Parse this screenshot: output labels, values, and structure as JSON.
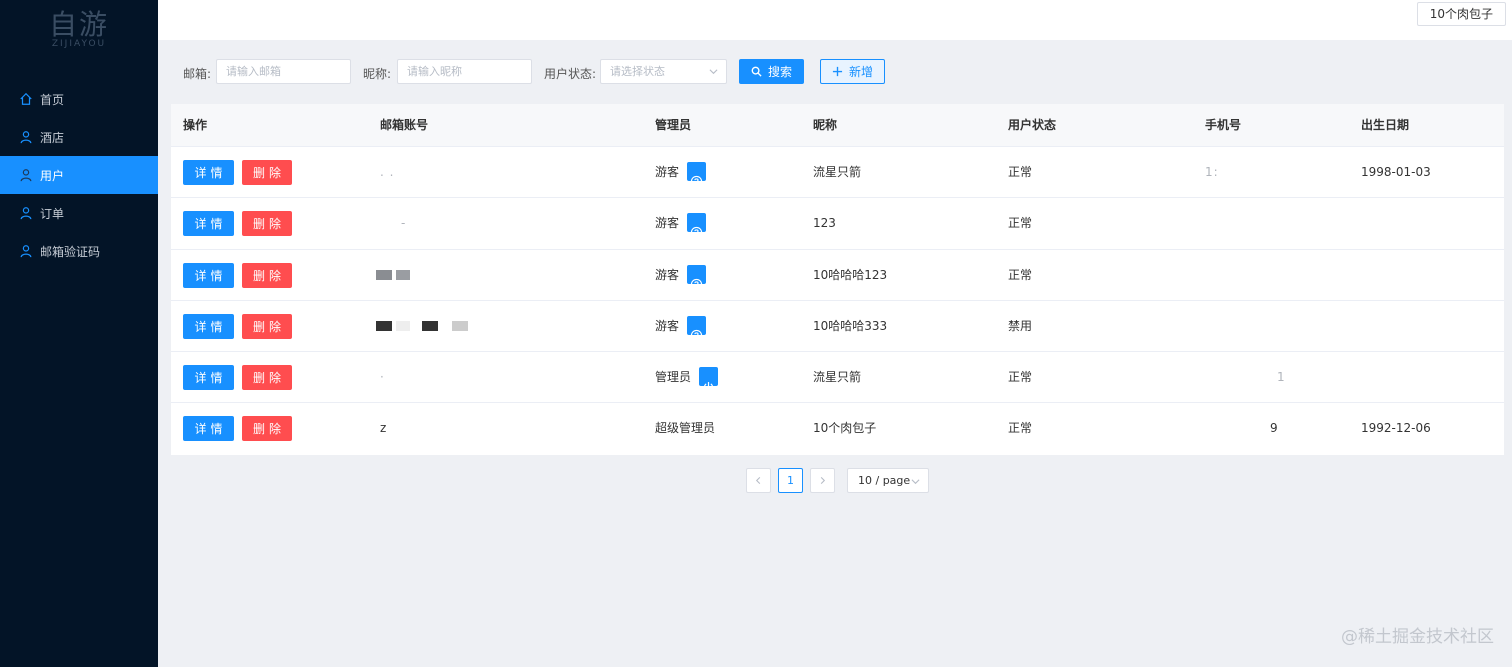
{
  "logo": {
    "title": "自游",
    "subtitle": "ZIJIAYOU"
  },
  "sidebar": {
    "items": [
      {
        "label": "首页",
        "icon": "home-icon"
      },
      {
        "label": "酒店",
        "icon": "user-icon"
      },
      {
        "label": "用户",
        "icon": "user-icon",
        "active": true
      },
      {
        "label": "订单",
        "icon": "user-icon"
      },
      {
        "label": "邮箱验证码",
        "icon": "user-icon"
      }
    ]
  },
  "header": {
    "user_name": "10个肉包子"
  },
  "search": {
    "email_label": "邮箱:",
    "email_placeholder": "请输入邮箱",
    "nickname_label": "昵称:",
    "nickname_placeholder": "请输入昵称",
    "status_label": "用户状态:",
    "status_placeholder": "请选择状态",
    "search_button": "搜索",
    "add_button": "新增"
  },
  "table": {
    "columns": [
      "操作",
      "邮箱账号",
      "管理员",
      "昵称",
      "用户状态",
      "手机号",
      "出生日期"
    ],
    "detail_label": "详情",
    "delete_label": "删除",
    "rows": [
      {
        "email": ". .",
        "role": "游客",
        "role_icon": "question-icon",
        "nickname": "流星只箭",
        "status": "正常",
        "phone": "1:",
        "birth": "1998-01-03"
      },
      {
        "email": "-",
        "role": "游客",
        "role_icon": "question-icon",
        "nickname": "123",
        "status": "正常",
        "phone": "",
        "birth": ""
      },
      {
        "email": "",
        "role": "游客",
        "role_icon": "question-icon",
        "nickname": "10哈哈哈123",
        "status": "正常",
        "phone": "",
        "birth": ""
      },
      {
        "email": "",
        "role": "游客",
        "role_icon": "question-icon",
        "nickname": "10哈哈哈333",
        "status": "禁用",
        "phone": "",
        "birth": ""
      },
      {
        "email": "·",
        "role": "管理员",
        "role_icon": "power-icon",
        "nickname": "流星只箭",
        "status": "正常",
        "phone": "1",
        "birth": ""
      },
      {
        "email": "z",
        "role": "超级管理员",
        "role_icon": "",
        "nickname": "10个肉包子",
        "status": "正常",
        "phone": "9",
        "birth": "1992-12-06"
      }
    ]
  },
  "pagination": {
    "current": "1",
    "page_size": "10 / page"
  },
  "watermark": "@稀土掘金技术社区",
  "colors": {
    "primary": "#1890ff",
    "danger": "#ff4d4f",
    "sidebar_bg": "#031427"
  }
}
